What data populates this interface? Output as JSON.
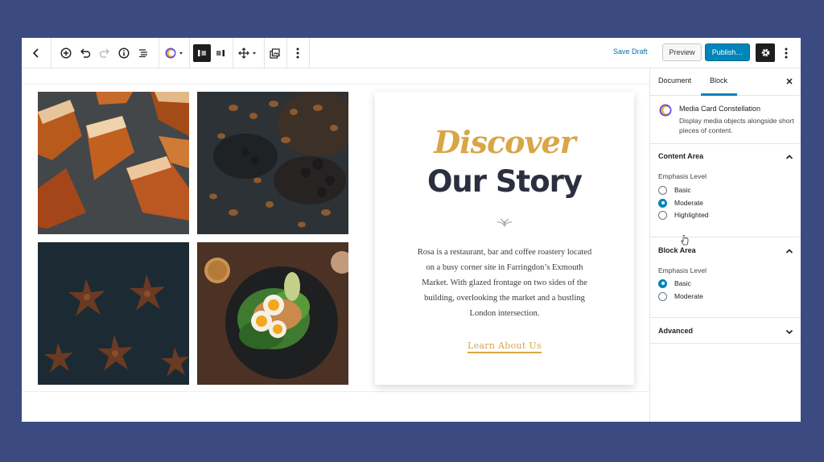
{
  "toolbar": {
    "save_draft_label": "Save Draft",
    "preview_label": "Preview",
    "publish_label": "Publish…"
  },
  "card": {
    "script_heading": "Discover",
    "heading": "Our Story",
    "description_lines": [
      "Rosa is a restaurant, bar and coffee roastery located",
      "on a busy corner site in Farringdon’s Exmouth",
      "Market. With glazed frontage on two sides of the",
      "building, overlooking the market and a bustling",
      "London intersection."
    ],
    "link_label": "Learn About Us"
  },
  "sidebar": {
    "tabs": [
      "Document",
      "Block"
    ],
    "active_tab": "Block",
    "block_title": "Media Card Constellation",
    "block_description": "Display media objects alongside short pieces of content.",
    "panels": {
      "content_area": {
        "title": "Content Area",
        "field_label": "Emphasis Level",
        "options": [
          "Basic",
          "Moderate",
          "Highlighted"
        ],
        "selected": "Moderate"
      },
      "block_area": {
        "title": "Block Area",
        "field_label": "Emphasis Level",
        "options": [
          "Basic",
          "Moderate"
        ],
        "selected": "Basic"
      },
      "advanced": {
        "title": "Advanced"
      }
    }
  },
  "colors": {
    "backdrop": "#3b4a80",
    "accent_blue": "#0085ba",
    "gold": "#d9a646",
    "heading_dark": "#2b2f3e"
  }
}
